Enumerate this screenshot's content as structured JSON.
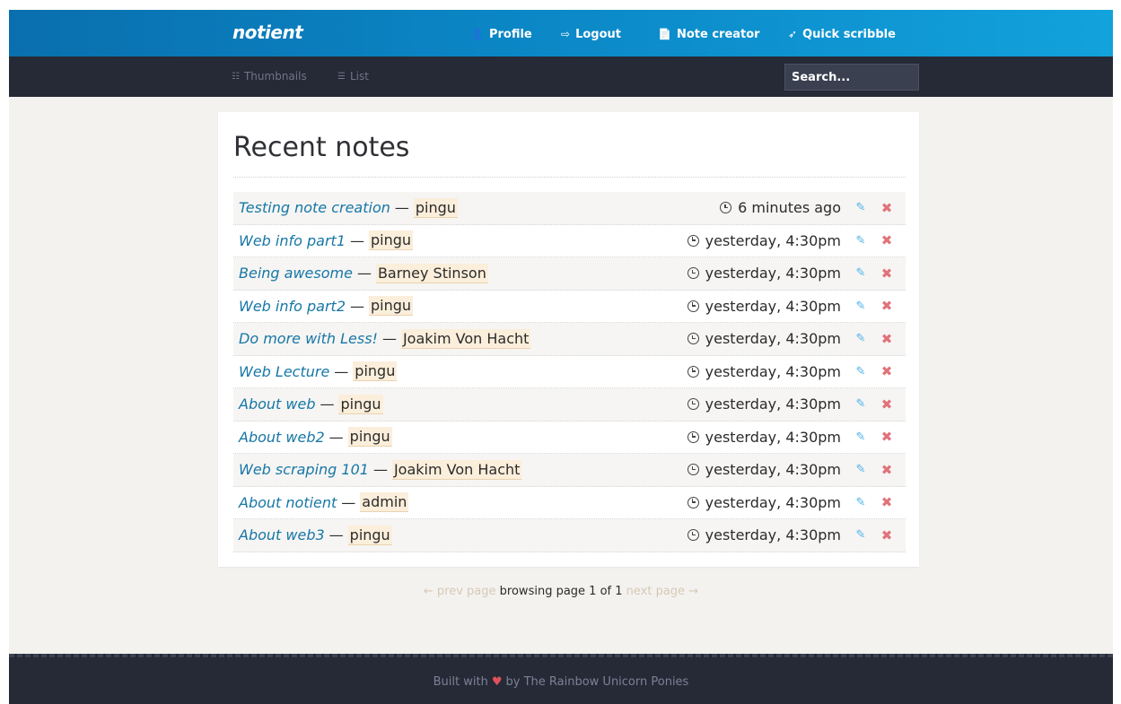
{
  "brand": "notient",
  "top_nav": [
    {
      "icon": "user-icon",
      "glyph": "👤",
      "label": "Profile"
    },
    {
      "icon": "logout-icon",
      "glyph": "⇨",
      "label": "Logout"
    },
    {
      "icon": "file-icon",
      "glyph": "📄",
      "label": "Note creator"
    },
    {
      "icon": "rocket-icon",
      "glyph": "➶",
      "label": "Quick scribble"
    }
  ],
  "view_modes": [
    {
      "icon": "grid-icon",
      "glyph": "☷",
      "label": "Thumbnails"
    },
    {
      "icon": "list-icon",
      "glyph": "☰",
      "label": "List"
    }
  ],
  "search": {
    "placeholder": "Search..."
  },
  "main": {
    "title": "Recent notes",
    "notes": [
      {
        "title": "Testing note creation",
        "author": "pingu",
        "time": "6 minutes ago"
      },
      {
        "title": "Web info part1",
        "author": "pingu",
        "time": "yesterday, 4:30pm"
      },
      {
        "title": "Being awesome",
        "author": "Barney Stinson",
        "time": "yesterday, 4:30pm"
      },
      {
        "title": "Web info part2",
        "author": "pingu",
        "time": "yesterday, 4:30pm"
      },
      {
        "title": "Do more with Less!",
        "author": "Joakim Von Hacht",
        "time": "yesterday, 4:30pm"
      },
      {
        "title": "Web Lecture",
        "author": "pingu",
        "time": "yesterday, 4:30pm"
      },
      {
        "title": "About web",
        "author": "pingu",
        "time": "yesterday, 4:30pm"
      },
      {
        "title": "About web2",
        "author": "pingu",
        "time": "yesterday, 4:30pm"
      },
      {
        "title": "Web scraping 101",
        "author": "Joakim Von Hacht",
        "time": "yesterday, 4:30pm"
      },
      {
        "title": "About notient",
        "author": "admin",
        "time": "yesterday, 4:30pm"
      },
      {
        "title": "About web3",
        "author": "pingu",
        "time": "yesterday, 4:30pm"
      }
    ]
  },
  "pagination": {
    "prev": "← prev page",
    "status": "browsing page 1 of 1",
    "next": "next page →"
  },
  "footer": {
    "prefix": "Built with",
    "heart": "♥",
    "suffix": "by The Rainbow Unicorn Ponies"
  },
  "colors": {
    "header_gradient_start": "#0a6fae",
    "header_gradient_end": "#12a2dc",
    "dark_bar": "#252a36",
    "link": "#1777a6",
    "author_highlight": "#fbeedb",
    "edit": "#4db3e6",
    "delete": "#e0737a"
  }
}
